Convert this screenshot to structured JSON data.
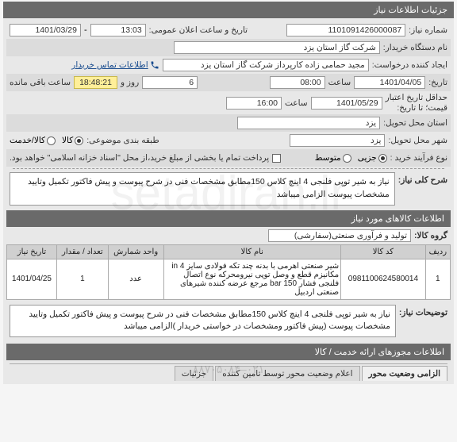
{
  "header_title": "جزئیات اطلاعات نیاز",
  "fields": {
    "need_no_label": "شماره نیاز:",
    "need_no": "1101091426000087",
    "announce_label": "تاریخ و ساعت اعلان عمومی:",
    "announce_time": "13:03",
    "announce_date": "1401/03/29",
    "buyer_label": "نام دستگاه خریدار:",
    "buyer": "شرکت گاز استان یزد",
    "creator_label": "ایجاد کننده درخواست:",
    "creator": "مجید حمامی زاده کارپرداز شرکت گاز استان یزد",
    "contact_link": "اطلاعات تماس خریدار",
    "date_label": "تاریخ:",
    "date_val": "1401/04/05",
    "time_label": "ساعت",
    "time_val": "08:00",
    "days_val": "6",
    "days_label": "روز و",
    "remain_label": "ساعت باقی مانده",
    "remain_timer": "18:48:21",
    "cred_until_label": "حداقل تاریخ اعتبار\nقیمت؛ تا تاریخ:",
    "cred_date": "1401/05/29",
    "cred_time": "16:00",
    "loc_province_label": "استان محل تحویل:",
    "loc_province": "یزد",
    "loc_city_label": "شهر محل تحویل:",
    "loc_city": "یزد",
    "class_label": "طبقه بندی موضوعی:",
    "class_opt_goods": "کالا",
    "class_opt_service": "کالا/خدمت",
    "process_label": "نوع فرآیند خرید :",
    "process_opt_partial": "جزیی",
    "process_opt_medium": "متوسط",
    "payment_note": "پرداخت تمام یا بخشی از مبلغ خرید،از محل \"اسناد خزانه اسلامی\" خواهد بود.",
    "main_desc_label": "شرح کلی نیاز:",
    "main_desc": "نیاز به شیر توپی فلنجی 4 اینچ کلاس 150مطابق مشخصات فنی در شرح پیوست و پیش فاکتور تکمیل وتایید مشخصات پیوست الزامی میباشد",
    "items_header": "اطلاعات کالاهای مورد نیاز",
    "group_label": "گروه کالا:",
    "group_val": "تولید و فرآوری صنعتی(سفارشی)",
    "col_row": "ردیف",
    "col_code": "کد کالا",
    "col_name": "نام کالا",
    "col_unit": "واحد شمارش",
    "col_qty": "تعداد / مقدار",
    "col_date": "تاریخ نیاز",
    "row1_idx": "1",
    "row1_code": "0981100624580014",
    "row1_name": "شیر صنعتی اهرمی با بدنه چند تکه فولادی سایز 4 in مکانیزم قطع و وصل توپی نیرومحرکه نوع اتصال فلنجی فشار bar 150 مرجع عرضه کننده شیرهای صنعتی اردبیل",
    "row1_unit": "عدد",
    "row1_qty": "1",
    "row1_date": "1401/04/25",
    "notes_label": "توضیحات نیاز:",
    "notes_text": "نیاز به شیر توپی فلنجی 4 اینچ کلاس 150مطابق مشخصات فنی در شرح پیوست و پیش فاکتور تکمیل وتایید مشخصات پیوست (پیش فاکتور ومشخصات در خواستی خریدار )الزامی میباشد",
    "licenses_header": "اطلاعات مجوزهای ارائه خدمت / کالا",
    "tab1": "الزامی وضعیت محور",
    "tab2": "اعلام وضعیت محور توسط تامین کننده",
    "tab3": "جزئیات"
  },
  "watermark": "setadiran.ir",
  "sub_number": "۰۲۱–۸۸۷۰۵۰۸۴"
}
